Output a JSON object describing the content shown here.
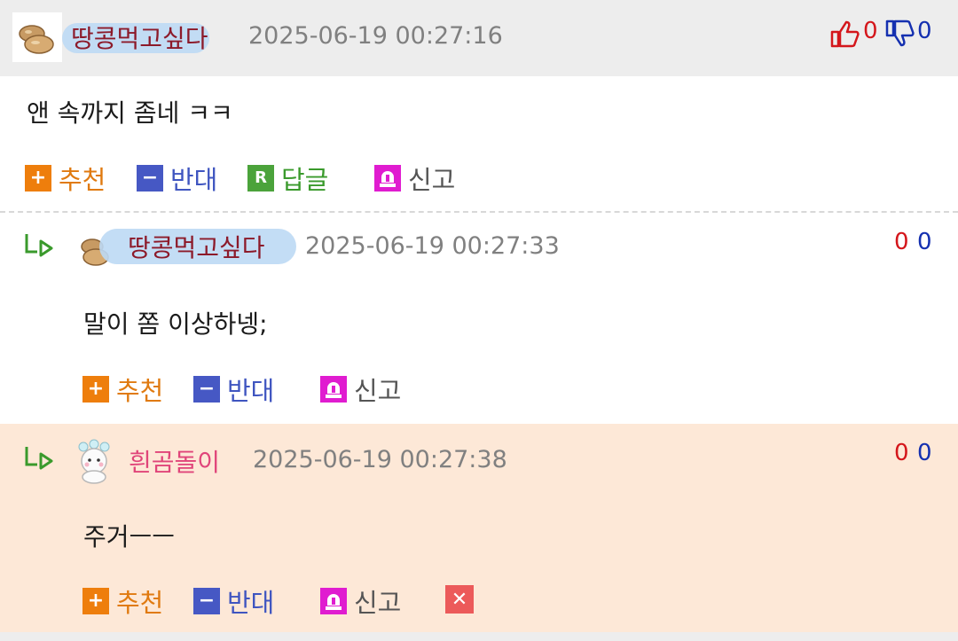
{
  "comments": [
    {
      "author": "땅콩먹고싶다",
      "timestamp": "2025-06-19 00:27:16",
      "upvotes": "0",
      "downvotes": "0",
      "text": "앤 속까지 좀네 ㅋㅋ",
      "actions": {
        "recommend": "추천",
        "oppose": "반대",
        "reply": "답글",
        "report": "신고"
      }
    },
    {
      "author": "땅콩먹고싶다",
      "timestamp": "2025-06-19 00:27:33",
      "upvotes": "0",
      "downvotes": "0",
      "text": "말이 쫌 이상하넹;",
      "actions": {
        "recommend": "추천",
        "oppose": "반대",
        "report": "신고"
      }
    },
    {
      "author": "흰곰돌이",
      "timestamp": "2025-06-19 00:27:38",
      "upvotes": "0",
      "downvotes": "0",
      "text": "주거ㅡㅡ",
      "actions": {
        "recommend": "추천",
        "oppose": "반대",
        "report": "신고"
      }
    }
  ],
  "icons": {
    "reply_arrow": "reply-arrow-icon",
    "peanut_avatar": "peanut-avatar-icon",
    "bear_avatar": "bear-avatar-icon",
    "thumbs_up": "thumbs-up-icon",
    "thumbs_down": "thumbs-down-icon",
    "siren": "siren-icon",
    "delete": "delete-icon"
  },
  "colors": {
    "author_dark": "#8c1a2a",
    "author_pink": "#e0457a",
    "recommend": "#ee7e0c",
    "oppose": "#4658c4",
    "reply": "#4ba33b",
    "report": "#e01cd0",
    "upvote": "#d4161b",
    "downvote": "#1530b0",
    "highlight_bg": "#fde8d7"
  }
}
